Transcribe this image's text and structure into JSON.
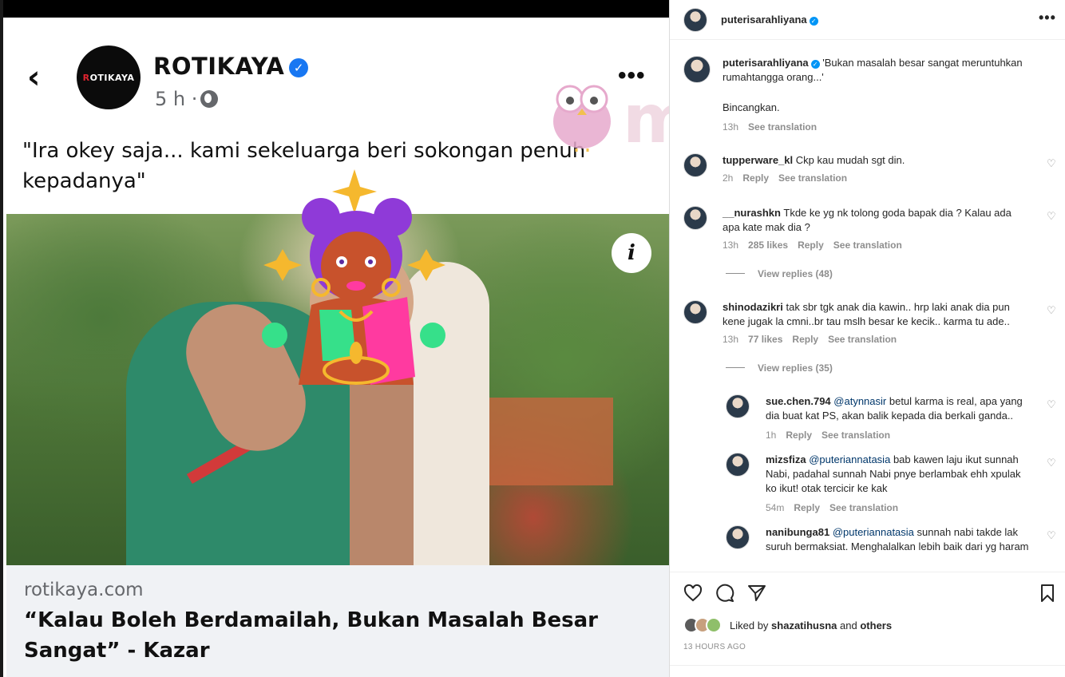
{
  "facebook": {
    "page_name": "ROTIKAYA",
    "avatar_text_a": "R",
    "avatar_text_b": "OTIKAYA",
    "time": "5 h",
    "dot": "·",
    "back_glyph": "‹",
    "more_glyph": "•••",
    "quote": "\"Ira okey saja... kami sekeluarga beri sokongan penuh kepadanya\"",
    "info_glyph": "i",
    "link": {
      "domain": "rotikaya.com",
      "title": "“Kalau Boleh Berdamailah, Bukan Masalah Besar Sangat” - Kazar"
    }
  },
  "watermark": {
    "text": "murai"
  },
  "instagram": {
    "header": {
      "username": "puterisarahliyana",
      "more_glyph": "•••"
    },
    "caption": {
      "username": "puterisarahliyana",
      "text": "'Bukan masalah besar sangat meruntuhkan rumahtangga orang...'",
      "text2": "Bincangkan.",
      "time": "13h",
      "translate": "See translation"
    },
    "comments": [
      {
        "username": "tupperware_kl",
        "text": "Ckp kau mudah sgt din.",
        "time": "2h",
        "likes": "",
        "reply": "Reply",
        "translate": "See translation"
      },
      {
        "username": "__nurashkn",
        "text": "Tkde ke yg nk tolong goda bapak dia ? Kalau ada apa kate mak dia ?",
        "time": "13h",
        "likes": "285 likes",
        "reply": "Reply",
        "translate": "See translation",
        "view_replies": "View replies (48)"
      },
      {
        "username": "shinodazikri",
        "text": "tak sbr tgk anak dia kawin.. hrp laki anak dia pun kene jugak la cmni..br tau mslh besar ke kecik.. karma tu ade..",
        "time": "13h",
        "likes": "77 likes",
        "reply": "Reply",
        "translate": "See translation",
        "view_replies": "View replies (35)"
      }
    ],
    "replies": [
      {
        "username": "sue.chen.794",
        "mention": "@atynnasir",
        "text": "betul karma is real, apa yang dia buat kat PS, akan balik kepada dia berkali ganda..",
        "time": "1h",
        "reply": "Reply",
        "translate": "See translation"
      },
      {
        "username": "mizsfiza",
        "mention": "@puteriannatasia",
        "text": "bab kawen laju ikut sunnah Nabi, padahal sunnah Nabi pnye berlambak ehh xpulak ko ikut! otak tercicir ke kak",
        "time": "54m",
        "reply": "Reply",
        "translate": "See translation"
      },
      {
        "username": "nanibunga81",
        "mention": "@puteriannatasia",
        "text": "sunnah nabi takde lak suruh bermaksiat. Menghalalkan lebih baik dari yg haram"
      }
    ],
    "heart_glyph": "♡",
    "actions": {
      "like_icon": "heart-outline",
      "comment_icon": "comment-bubble",
      "share_icon": "paper-plane",
      "save_icon": "bookmark"
    },
    "liked_by_prefix": "Liked by",
    "liked_by_user": "shazatihusna",
    "liked_by_and": "and",
    "liked_by_others": "others",
    "time_ago": "13 HOURS AGO"
  },
  "colors": {
    "fb_blue": "#1877f2",
    "ig_blue": "#0095f6",
    "mention": "#00376b",
    "muted": "#8e8e8e",
    "watermark_pink": "#e6becd"
  }
}
